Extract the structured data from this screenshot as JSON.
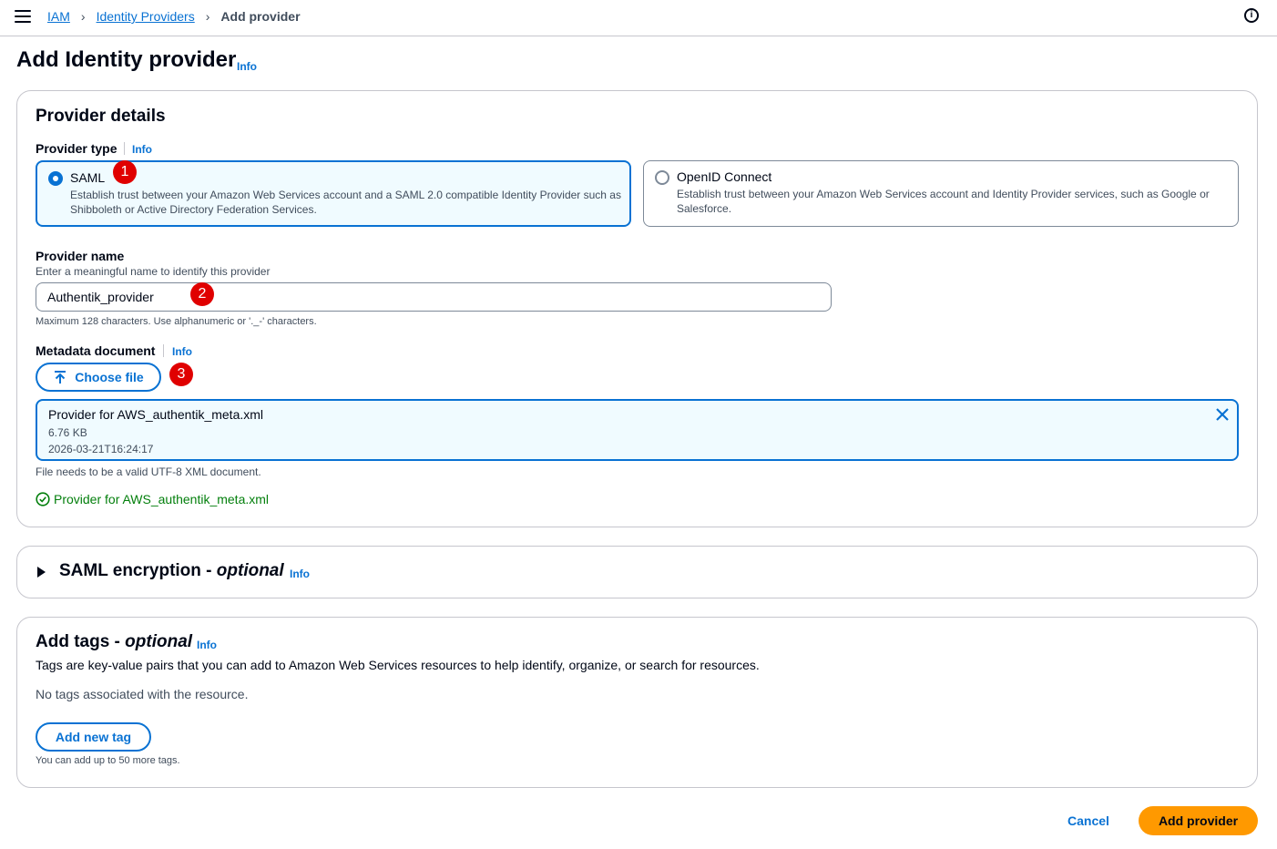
{
  "header": {
    "breadcrumbs": [
      "IAM",
      "Identity Providers",
      "Add provider"
    ]
  },
  "page": {
    "title": "Add Identity provider",
    "info": "Info"
  },
  "provider_details": {
    "heading": "Provider details",
    "provider_type": {
      "label": "Provider type",
      "info": "Info",
      "options": [
        {
          "title": "SAML",
          "description": "Establish trust between your Amazon Web Services account and a SAML 2.0 compatible Identity Provider such as Shibboleth or Active Directory Federation Services.",
          "selected": true
        },
        {
          "title": "OpenID Connect",
          "description": "Establish trust between your Amazon Web Services account and Identity Provider services, such as Google or Salesforce.",
          "selected": false
        }
      ]
    },
    "provider_name": {
      "label": "Provider name",
      "description": "Enter a meaningful name to identify this provider",
      "value": "Authentik_provider",
      "constraint": "Maximum 128 characters. Use alphanumeric or '._-' characters."
    },
    "metadata": {
      "label": "Metadata document",
      "info": "Info",
      "choose_file": "Choose file",
      "file_name": "Provider for AWS_authentik_meta.xml",
      "file_size": "6.76 KB",
      "file_date": "2026-03-21T16:24:17",
      "constraint": "File needs to be a valid UTF-8 XML document.",
      "success": "Provider for AWS_authentik_meta.xml"
    }
  },
  "saml_encryption": {
    "heading": "SAML encryption - ",
    "optional": "optional",
    "info": "Info"
  },
  "tags": {
    "heading": "Add tags - ",
    "optional": "optional",
    "info": "Info",
    "description": "Tags are key-value pairs that you can add to Amazon Web Services resources to help identify, organize, or search for resources.",
    "empty": "No tags associated with the resource.",
    "add_button": "Add new tag",
    "limit": "You can add up to 50 more tags."
  },
  "footer": {
    "cancel": "Cancel",
    "submit": "Add provider"
  },
  "annotations": [
    "1",
    "2",
    "3"
  ],
  "icons": {
    "menu": "menu-icon",
    "help": "info-circle-icon",
    "upload": "upload-arrow-icon",
    "close": "close-icon",
    "success": "check-circle-icon",
    "expand": "caret-right-icon"
  },
  "colors": {
    "link": "#0972d3",
    "primary": "#ff9900",
    "success": "#037f0c",
    "annotation": "#e00000"
  }
}
